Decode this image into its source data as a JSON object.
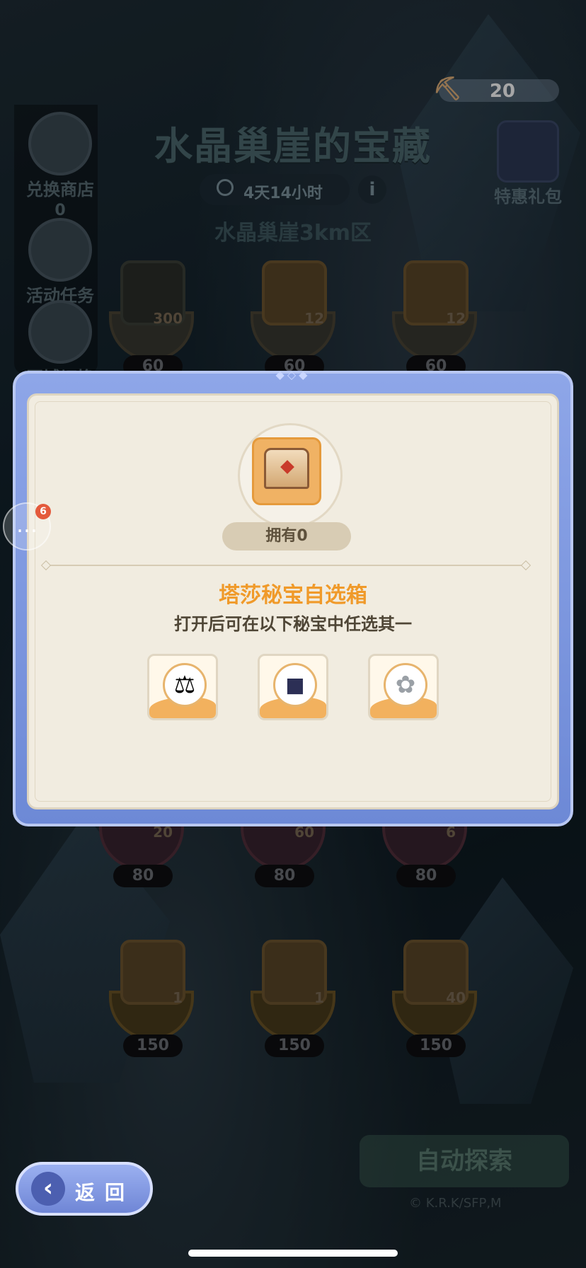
{
  "header": {
    "pickaxe_count": "20",
    "title": "水晶巢崖的宝藏",
    "timer": "4天14小时",
    "zone": "水晶巢崖3km区",
    "gift_label": "特惠礼包"
  },
  "sidebar": {
    "items": [
      {
        "label": "兑换商店",
        "count": "0"
      },
      {
        "label": "活动任务"
      },
      {
        "label": "区域切换"
      }
    ]
  },
  "board": {
    "row1": [
      {
        "qty": "300",
        "cost": "60"
      },
      {
        "qty": "12",
        "cost": "60"
      },
      {
        "qty": "12",
        "cost": "60"
      }
    ],
    "row3": [
      {
        "qty": "20",
        "cost": "80"
      },
      {
        "qty": "60",
        "cost": "80"
      },
      {
        "qty": "6",
        "cost": "80"
      }
    ],
    "row4": [
      {
        "qty": "1",
        "cost": "150"
      },
      {
        "qty": "1",
        "cost": "150"
      },
      {
        "qty": "40",
        "cost": "150"
      }
    ]
  },
  "auto_explore_label": "自动探索",
  "copyright": "© K.R.K/SFP,M",
  "back_label": "返回",
  "chat_badge": "6",
  "modal": {
    "owned": "拥有0",
    "item_name": "塔莎秘宝自选箱",
    "item_desc": "打开后可在以下秘宝中任选其一",
    "choices": [
      "scales-relic",
      "dark-gauntlet-relic",
      "silver-flower-relic"
    ]
  },
  "colors": {
    "accent_orange": "#f09a2a",
    "modal_frame": "#8ea6e8",
    "modal_bg": "#f1ece0"
  }
}
